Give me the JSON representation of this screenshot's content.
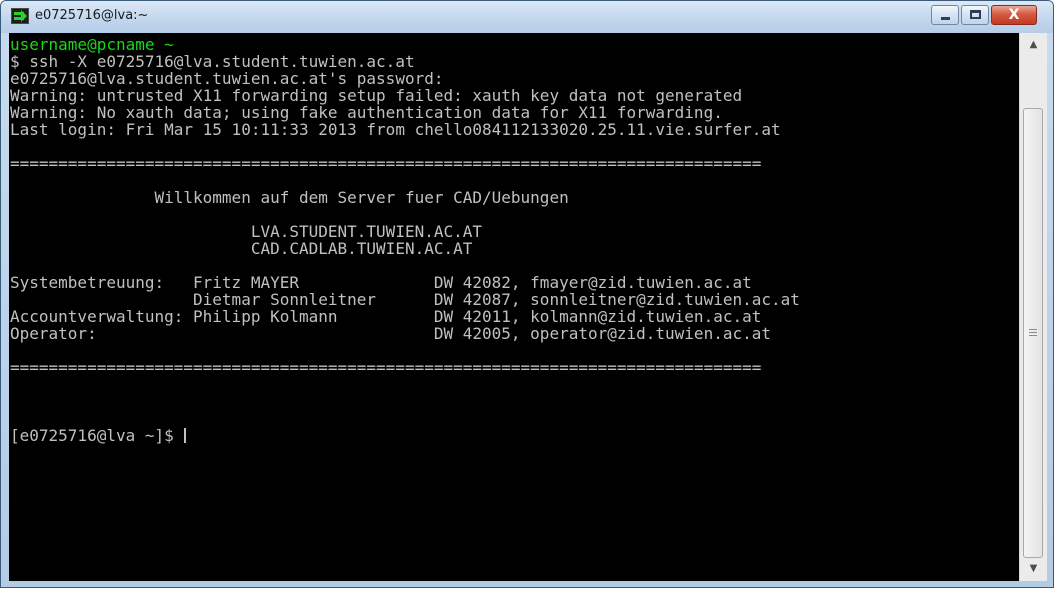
{
  "window": {
    "title": "e0725716@lva:~",
    "icon": "terminal-icon",
    "controls": {
      "minimize": "minimize-icon",
      "maximize": "maximize-icon",
      "close_glyph": "X"
    }
  },
  "terminal": {
    "colors": {
      "background": "#000000",
      "text": "#c0c0c0",
      "prompt_green": "#17d917"
    },
    "lines": [
      "username@pcname ~",
      "$ ssh -X e0725716@lva.student.tuwien.ac.at",
      "e0725716@lva.student.tuwien.ac.at's password:",
      "Warning: untrusted X11 forwarding setup failed: xauth key data not generated",
      "Warning: No xauth data; using fake authentication data for X11 forwarding.",
      "Last login: Fri Mar 15 10:11:33 2013 from chello084112133020.25.11.vie.surfer.at",
      "",
      "==============================================================================",
      "",
      "               Willkommen auf dem Server fuer CAD/Uebungen",
      "",
      "                         LVA.STUDENT.TUWIEN.AC.AT",
      "                         CAD.CADLAB.TUWIEN.AC.AT",
      "",
      "Systembetreuung:   Fritz MAYER              DW 42082, fmayer@zid.tuwien.ac.at",
      "                   Dietmar Sonnleitner      DW 42087, sonnleitner@zid.tuwien.ac.at",
      "Accountverwaltung: Philipp Kolmann          DW 42011, kolmann@zid.tuwien.ac.at",
      "Operator:                                   DW 42005, operator@zid.tuwien.ac.at",
      "",
      "==============================================================================",
      "",
      "",
      ""
    ],
    "prompt": "[e0725716@lva ~]$ "
  },
  "scrollbar": {
    "up_arrow": "▲",
    "down_arrow": "▼"
  }
}
